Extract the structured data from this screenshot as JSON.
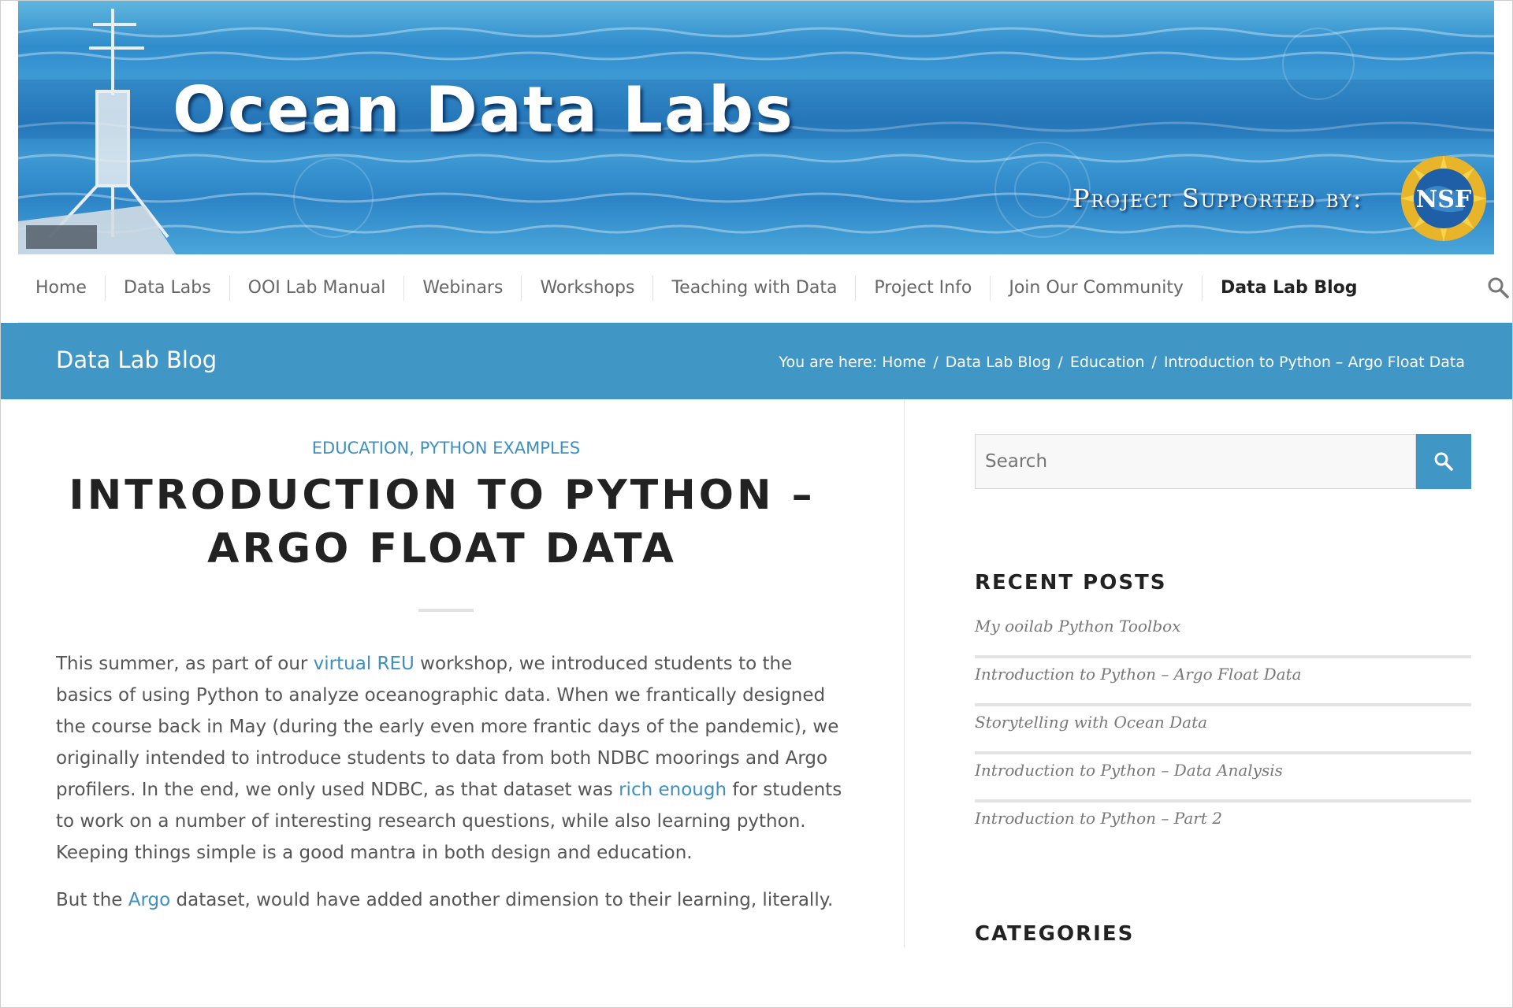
{
  "banner": {
    "title": "Ocean Data Labs",
    "supported": "Project Supported by:",
    "logo_text": "NSF"
  },
  "nav": {
    "items": [
      "Home",
      "Data Labs",
      "OOI Lab Manual",
      "Webinars",
      "Workshops",
      "Teaching with Data",
      "Project Info",
      "Join Our Community",
      "Data Lab Blog"
    ],
    "active": "Data Lab Blog"
  },
  "titlebar": {
    "title": "Data Lab Blog",
    "breadcrumb_prefix": "You are here:",
    "crumbs": [
      "Home",
      "Data Lab Blog",
      "Education",
      "Introduction to Python – Argo Float Data"
    ]
  },
  "post": {
    "categories": [
      "EDUCATION",
      "PYTHON EXAMPLES"
    ],
    "title_line1": "INTRODUCTION TO PYTHON –",
    "title_line2": "ARGO FLOAT DATA",
    "p1": {
      "t1": "This summer, as part of our ",
      "link1": "virtual REU",
      "t2": " workshop, we introduced students to the basics of using Python to analyze oceanographic data. When we frantically designed the course back in May (during the early even more frantic days of the pandemic), we originally intended to introduce students to data from both NDBC moorings and Argo profilers.  In the end, we only used NDBC, as that dataset was ",
      "link2": "rich enough",
      "t3": " for students to work on a number of interesting research questions, while also learning python. Keeping things simple is a good mantra in both design and education."
    },
    "p2": {
      "t1": "But the ",
      "link1": "Argo",
      "t2": " dataset, would have added another dimension to their learning, literally."
    }
  },
  "sidebar": {
    "search_placeholder": "Search",
    "recent_title": "RECENT POSTS",
    "recent": [
      "My ooilab Python Toolbox",
      "Introduction to Python – Argo Float Data",
      "Storytelling with Ocean Data",
      "Introduction to Python – Data Analysis",
      "Introduction to Python – Part 2"
    ],
    "categories_title": "CATEGORIES"
  },
  "colors": {
    "accent": "#4096c4",
    "link": "#3d8fbf"
  }
}
